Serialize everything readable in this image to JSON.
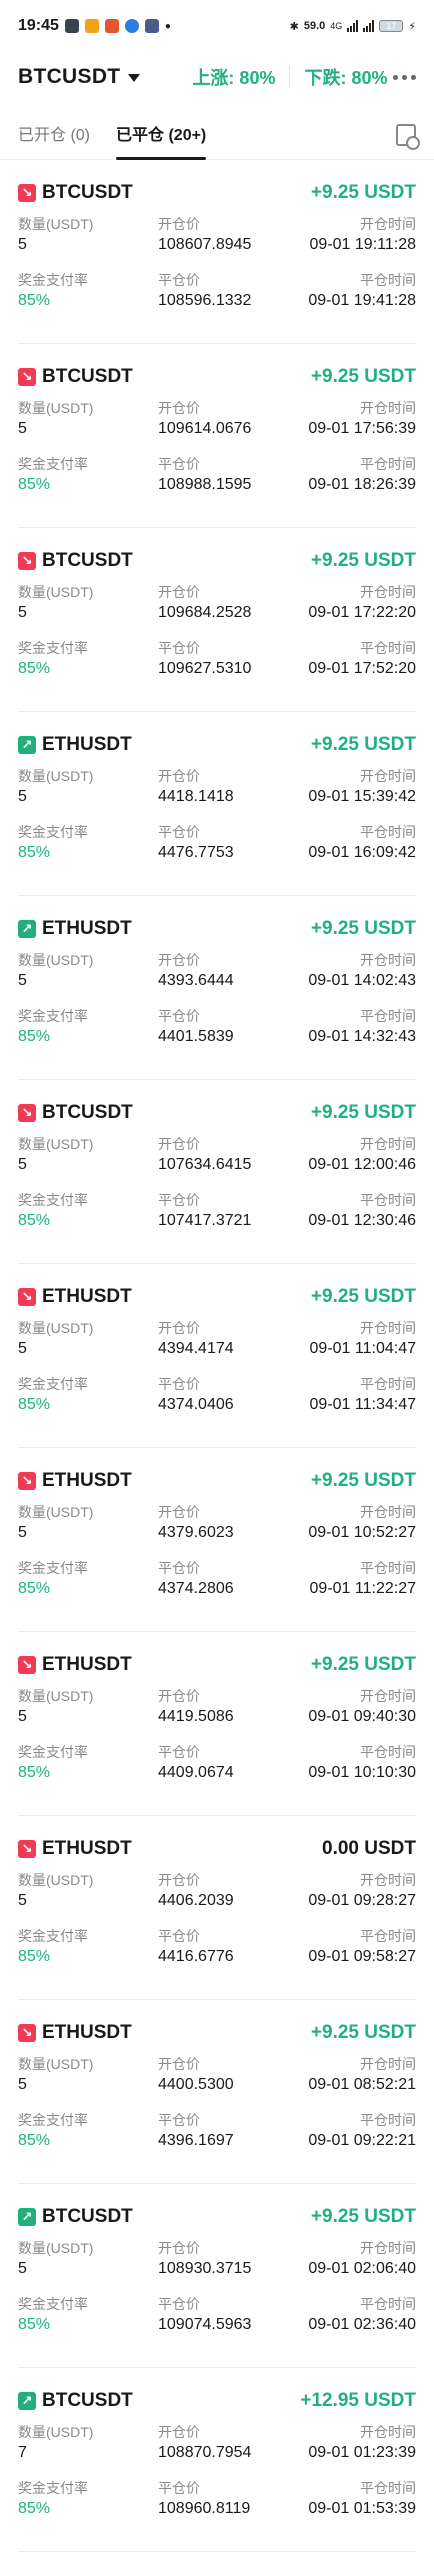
{
  "status_bar": {
    "time": "19:45",
    "speed": "59.0",
    "network": "4G",
    "battery": "17"
  },
  "header": {
    "pair": "BTCUSDT",
    "up_rate": "上涨: 80%",
    "down_rate": "下跌: 80%"
  },
  "tabs": {
    "open": "已开仓 (0)",
    "closed": "已平仓 (20+)"
  },
  "labels": {
    "qty": "数量(USDT)",
    "open_price": "开仓价",
    "open_time": "开仓时间",
    "payout": "奖金支付率",
    "close_price": "平仓价",
    "close_time": "平仓时间"
  },
  "colors": {
    "green": "#22b07d",
    "red": "#ef3b53"
  },
  "trades": [
    {
      "symbol": "BTCUSDT",
      "direction": "down",
      "pnl": "+9.25 USDT",
      "qty": "5",
      "open_price": "108607.8945",
      "open_time": "09-01 19:11:28",
      "payout": "85%",
      "close_price": "108596.1332",
      "close_time": "09-01 19:41:28"
    },
    {
      "symbol": "BTCUSDT",
      "direction": "down",
      "pnl": "+9.25 USDT",
      "qty": "5",
      "open_price": "109614.0676",
      "open_time": "09-01 17:56:39",
      "payout": "85%",
      "close_price": "108988.1595",
      "close_time": "09-01 18:26:39"
    },
    {
      "symbol": "BTCUSDT",
      "direction": "down",
      "pnl": "+9.25 USDT",
      "qty": "5",
      "open_price": "109684.2528",
      "open_time": "09-01 17:22:20",
      "payout": "85%",
      "close_price": "109627.5310",
      "close_time": "09-01 17:52:20"
    },
    {
      "symbol": "ETHUSDT",
      "direction": "up",
      "pnl": "+9.25 USDT",
      "qty": "5",
      "open_price": "4418.1418",
      "open_time": "09-01 15:39:42",
      "payout": "85%",
      "close_price": "4476.7753",
      "close_time": "09-01 16:09:42"
    },
    {
      "symbol": "ETHUSDT",
      "direction": "up",
      "pnl": "+9.25 USDT",
      "qty": "5",
      "open_price": "4393.6444",
      "open_time": "09-01 14:02:43",
      "payout": "85%",
      "close_price": "4401.5839",
      "close_time": "09-01 14:32:43"
    },
    {
      "symbol": "BTCUSDT",
      "direction": "down",
      "pnl": "+9.25 USDT",
      "qty": "5",
      "open_price": "107634.6415",
      "open_time": "09-01 12:00:46",
      "payout": "85%",
      "close_price": "107417.3721",
      "close_time": "09-01 12:30:46"
    },
    {
      "symbol": "ETHUSDT",
      "direction": "down",
      "pnl": "+9.25 USDT",
      "qty": "5",
      "open_price": "4394.4174",
      "open_time": "09-01 11:04:47",
      "payout": "85%",
      "close_price": "4374.0406",
      "close_time": "09-01 11:34:47"
    },
    {
      "symbol": "ETHUSDT",
      "direction": "down",
      "pnl": "+9.25 USDT",
      "qty": "5",
      "open_price": "4379.6023",
      "open_time": "09-01 10:52:27",
      "payout": "85%",
      "close_price": "4374.2806",
      "close_time": "09-01 11:22:27"
    },
    {
      "symbol": "ETHUSDT",
      "direction": "down",
      "pnl": "+9.25 USDT",
      "qty": "5",
      "open_price": "4419.5086",
      "open_time": "09-01 09:40:30",
      "payout": "85%",
      "close_price": "4409.0674",
      "close_time": "09-01 10:10:30"
    },
    {
      "symbol": "ETHUSDT",
      "direction": "down",
      "pnl": "0.00 USDT",
      "qty": "5",
      "open_price": "4406.2039",
      "open_time": "09-01 09:28:27",
      "payout": "85%",
      "close_price": "4416.6776",
      "close_time": "09-01 09:58:27"
    },
    {
      "symbol": "ETHUSDT",
      "direction": "down",
      "pnl": "+9.25 USDT",
      "qty": "5",
      "open_price": "4400.5300",
      "open_time": "09-01 08:52:21",
      "payout": "85%",
      "close_price": "4396.1697",
      "close_time": "09-01 09:22:21"
    },
    {
      "symbol": "BTCUSDT",
      "direction": "up",
      "pnl": "+9.25 USDT",
      "qty": "5",
      "open_price": "108930.3715",
      "open_time": "09-01 02:06:40",
      "payout": "85%",
      "close_price": "109074.5963",
      "close_time": "09-01 02:36:40"
    },
    {
      "symbol": "BTCUSDT",
      "direction": "up",
      "pnl": "+12.95 USDT",
      "qty": "7",
      "open_price": "108870.7954",
      "open_time": "09-01 01:23:39",
      "payout": "85%",
      "close_price": "108960.8119",
      "close_time": "09-01 01:53:39"
    }
  ]
}
